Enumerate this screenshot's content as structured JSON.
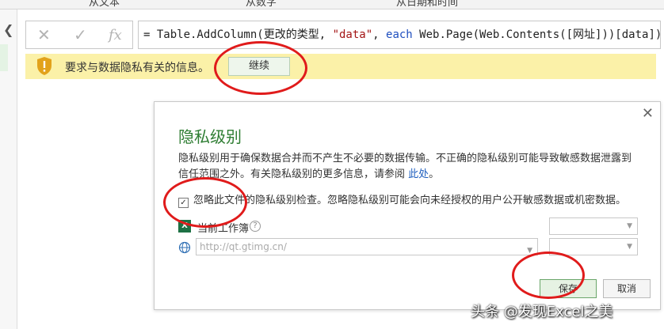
{
  "ribbon": {
    "tabs": [
      "从文本",
      "从数字",
      "从日期和时间"
    ]
  },
  "formula_bar": {
    "cancel_icon": "x-icon",
    "confirm_icon": "check-icon",
    "fx_label": "fx",
    "formula_prefix": "= Table.AddColumn(更改的类型, ",
    "formula_string": "\"data\"",
    "formula_mid": ", ",
    "formula_keyword": "each",
    "formula_suffix": " Web.Page(Web.Contents([网址]))[data])"
  },
  "warning_bar": {
    "icon": "shield-warning-icon",
    "message": "要求与数据隐私有关的信息。",
    "continue_label": "继续"
  },
  "dialog": {
    "title": "隐私级别",
    "description": "隐私级别用于确保数据合并而不产生不必要的数据传输。不正确的隐私级别可能导致敏感数据泄露到信任范围之外。有关隐私级别的更多信息，请参阅 ",
    "link_text": "此处",
    "link_suffix": "。",
    "ignore_checkbox_checked": true,
    "ignore_checkbox_label": "忽略此文件的隐私级别检查。忽略隐私级别可能会向未经授权的用户公开敏感数据或机密数据。",
    "current_workbook_label": "当前工作簿",
    "url_placeholder": "http://qt.gtimg.cn/",
    "save_label": "保存",
    "cancel_label": "取消"
  },
  "watermark": "头条 @发现Excel之美",
  "colors": {
    "warning_bg": "#fbf1a8",
    "title_green": "#2e7d32",
    "highlight_red": "#e01b1b",
    "excel_green": "#1e7145"
  }
}
